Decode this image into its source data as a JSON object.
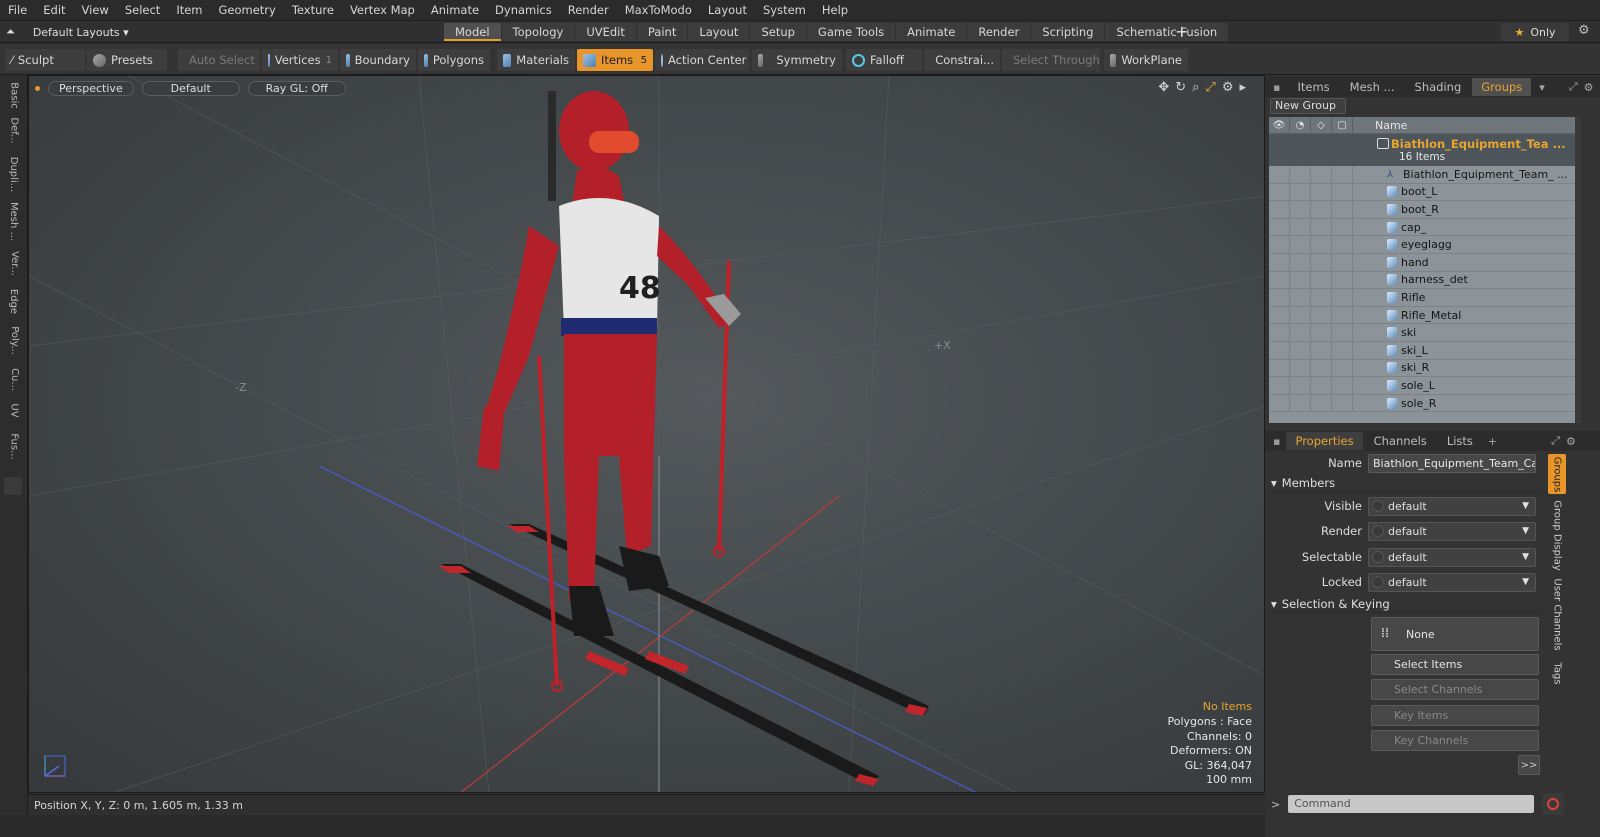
{
  "menu": [
    "File",
    "Edit",
    "View",
    "Select",
    "Item",
    "Geometry",
    "Texture",
    "Vertex Map",
    "Animate",
    "Dynamics",
    "Render",
    "MaxToModo",
    "Layout",
    "System",
    "Help"
  ],
  "layout_selector": "Default Layouts",
  "mode_tabs": [
    "Model",
    "Topology",
    "UVEdit",
    "Paint",
    "Layout",
    "Setup",
    "Game Tools",
    "Animate",
    "Render",
    "Scripting",
    "Schematic Fusion"
  ],
  "active_mode_tab": "Model",
  "only_label": "Only",
  "toolbar": {
    "sculpt": "Sculpt",
    "presets": "Presets",
    "auto_select": "Auto Select",
    "vertices": "Vertices",
    "vertices_count": "1",
    "boundary": "Boundary",
    "polygons": "Polygons",
    "materials": "Materials",
    "items": "Items",
    "items_count": "5",
    "action_center": "Action Center",
    "symmetry": "Symmetry",
    "falloff": "Falloff",
    "constraints": "Constrai...",
    "select_through": "Select Through",
    "workplane": "WorkPlane"
  },
  "left_tabs": [
    "Basic",
    "Def...",
    "Dupli...",
    "Mesh ...",
    "Ver...",
    "Edge",
    "Poly...",
    "Cu...",
    "UV",
    "Fus..."
  ],
  "viewport": {
    "view": "Perspective",
    "shading": "Default",
    "raygl": "Ray GL: Off",
    "axis_neg_z": "-Z",
    "axis_pos_x": "+X",
    "info": {
      "items": "No Items",
      "polygons": "Polygons : Face",
      "channels": "Channels: 0",
      "deformers": "Deformers: ON",
      "gl": "GL: 364,047",
      "unit": "100 mm"
    }
  },
  "status": "Position X, Y, Z:  0 m, 1.605 m, 1.33 m",
  "groups_panel": {
    "tabs": [
      "Items",
      "Mesh ...",
      "Shading",
      "Groups"
    ],
    "active_tab": "Groups",
    "new_group": "New Group",
    "col_name": "Name",
    "root_name": "Biathlon_Equipment_Tea ...",
    "root_count": "16 Items",
    "items": [
      "Biathlon_Equipment_Team_ ...",
      "boot_L",
      "boot_R",
      "cap_",
      "eyeglagg",
      "hand",
      "harness_det",
      "Rifle",
      "Rifle_Metal",
      "ski",
      "ski_L",
      "ski_R",
      "sole_L",
      "sole_R"
    ]
  },
  "properties": {
    "tabs": [
      "Properties",
      "Channels",
      "Lists"
    ],
    "active_tab": "Properties",
    "name_label": "Name",
    "name_value": "Biathlon_Equipment_Team_Canad",
    "members_section": "Members",
    "visible_label": "Visible",
    "render_label": "Render",
    "selectable_label": "Selectable",
    "locked_label": "Locked",
    "dropdown_value": "default",
    "selection_section": "Selection & Keying",
    "none_label": "None",
    "select_items": "Select Items",
    "select_channels": "Select Channels",
    "key_items": "Key Items",
    "key_channels": "Key Channels",
    "more": ">>",
    "side_tabs": [
      "Groups",
      "Group Display",
      "User Channels",
      "Tags"
    ]
  },
  "command_placeholder": "Command",
  "colors": {
    "accent": "#e8962a",
    "list_bg": "#8c9499",
    "root_text": "#e8a530"
  }
}
